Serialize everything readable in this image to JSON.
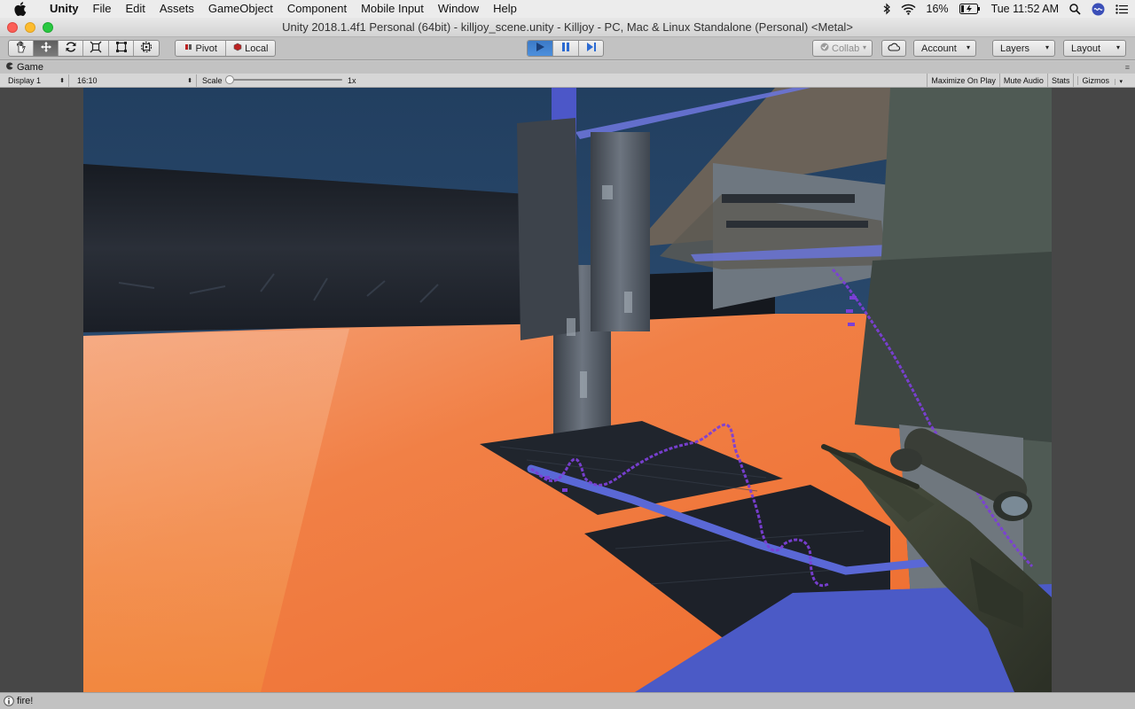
{
  "menubar": {
    "app": "Unity",
    "items": [
      "File",
      "Edit",
      "Assets",
      "GameObject",
      "Component",
      "Mobile Input",
      "Window",
      "Help"
    ],
    "battery": "16%",
    "clock": "Tue 11:52 AM"
  },
  "window": {
    "title": "Unity 2018.1.4f1 Personal (64bit) - killjoy_scene.unity - Killjoy - PC, Mac & Linux Standalone (Personal) <Metal>"
  },
  "toolbar": {
    "transform_tools": [
      "hand-icon",
      "move-icon",
      "rotate-icon",
      "scale-icon",
      "rect-icon",
      "transform-icon"
    ],
    "pivot_label": "Pivot",
    "local_label": "Local",
    "collab_label": "Collab",
    "account_label": "Account",
    "layers_label": "Layers",
    "layout_label": "Layout"
  },
  "game_view": {
    "tab_label": "Game",
    "display": "Display 1",
    "aspect": "16:10",
    "scale_label": "Scale",
    "scale_value": "1x",
    "scale_level": 0,
    "toggles": [
      "Maximize On Play",
      "Mute Audio",
      "Stats",
      "Gizmos"
    ]
  },
  "status": {
    "message": "fire!"
  },
  "colors": {
    "play_active": "#4a8ad6",
    "floor_orange": "#f07a3a",
    "sky": "#2d5078",
    "laser": "#7b3fd6"
  }
}
